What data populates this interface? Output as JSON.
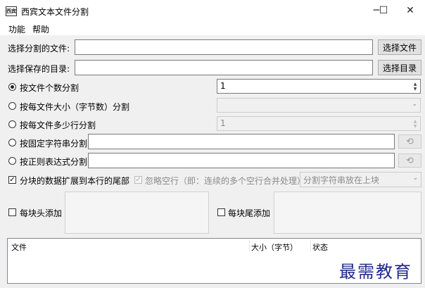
{
  "window": {
    "title": "西宾文本文件分割",
    "icon": "西宾",
    "controls": {
      "minimize": "─",
      "maximize": "☐",
      "close": "✕"
    }
  },
  "menu": {
    "items": [
      "功能",
      "帮助"
    ]
  },
  "file_select": {
    "label": "选择分割的文件:",
    "value": "",
    "button": "选择文件"
  },
  "dir_select": {
    "label": "选择保存的目录:",
    "value": "",
    "button": "选择目录"
  },
  "split_modes": [
    {
      "label": "按文件个数分割",
      "checked": true,
      "value": "1"
    },
    {
      "label": "按每文件大小（字节数）分割",
      "checked": false,
      "value": ""
    },
    {
      "label": "按每文件多少行分割",
      "checked": false,
      "value": "1"
    },
    {
      "label": "按固定字符串分割",
      "checked": false,
      "value": ""
    },
    {
      "label": "按正则表达式分割",
      "checked": false,
      "value": ""
    }
  ],
  "reset_icon": "⟲",
  "options": {
    "extend_label": "分块的数据扩展到本行的尾部",
    "extend_checked": true,
    "ignore_empty_label": "忽略空行（即：连续的多个空行合并处理）",
    "ignore_empty_checked": true,
    "placement_value": "分割字符串放在上块"
  },
  "head_add": {
    "label": "每块头添加",
    "checked": false
  },
  "tail_add": {
    "label": "每块尾添加",
    "checked": false
  },
  "file_list": {
    "columns": [
      "文件",
      "大小（字节）",
      "状态"
    ]
  },
  "watermark": "最需教育"
}
